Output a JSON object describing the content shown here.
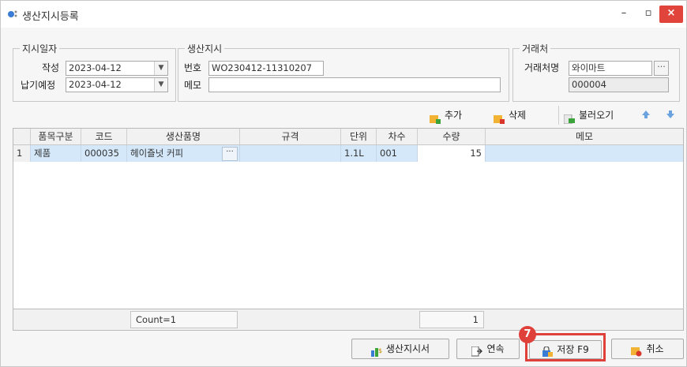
{
  "window": {
    "title": "생산지시등록",
    "minimize": "–",
    "maximize": "▫",
    "close": "×"
  },
  "group_dates": {
    "legend": "지시일자",
    "written_label": "작성",
    "written_value": "2023-04-12",
    "due_label": "납기예정",
    "due_value": "2023-04-12"
  },
  "group_order": {
    "legend": "생산지시",
    "number_label": "번호",
    "number_value": "WO230412-11310207",
    "memo_label": "메모",
    "memo_value": ""
  },
  "group_client": {
    "legend": "거래처",
    "name_label": "거래처명",
    "name_value": "와이마트",
    "code_value": "000004"
  },
  "toolbar": {
    "add": "추가",
    "delete": "삭제",
    "load": "불러오기"
  },
  "grid": {
    "columns": [
      "품목구분",
      "코드",
      "생산품명",
      "규격",
      "단위",
      "차수",
      "수량",
      "메모"
    ],
    "rows": [
      {
        "index": "1",
        "category": "제품",
        "code": "000035",
        "product": "헤이즐넛 커피",
        "spec": "",
        "unit": "1.1L",
        "batch": "001",
        "qty": "15",
        "memo": ""
      }
    ],
    "footer_count": "Count=1",
    "footer_qty_sum": "1"
  },
  "buttons": {
    "order_sheet": "생산지시서",
    "continuous": "연속",
    "save": "저장 F9",
    "cancel": "취소"
  },
  "annotation": {
    "step": "7"
  },
  "colors": {
    "accent": "#e0403a",
    "selected_row": "#d4e8fa"
  }
}
